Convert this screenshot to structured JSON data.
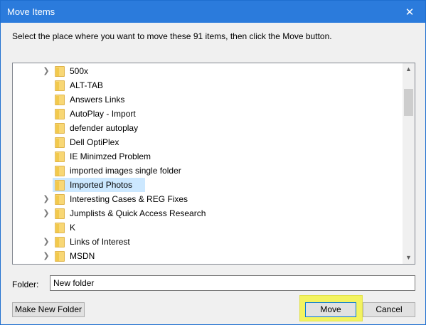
{
  "window": {
    "title": "Move Items"
  },
  "instruction": "Select the place where you want to move these 91 items, then click the Move button.",
  "tree": {
    "items": [
      {
        "label": "500x",
        "expandable": true,
        "selected": false
      },
      {
        "label": "ALT-TAB",
        "expandable": false,
        "selected": false
      },
      {
        "label": "Answers Links",
        "expandable": false,
        "selected": false
      },
      {
        "label": "AutoPlay - Import",
        "expandable": false,
        "selected": false
      },
      {
        "label": "defender autoplay",
        "expandable": false,
        "selected": false
      },
      {
        "label": "Dell OptiPlex",
        "expandable": false,
        "selected": false
      },
      {
        "label": "IE Minimzed Problem",
        "expandable": false,
        "selected": false
      },
      {
        "label": "imported images single folder",
        "expandable": false,
        "selected": false
      },
      {
        "label": "Imported Photos",
        "expandable": false,
        "selected": true
      },
      {
        "label": "Interesting Cases & REG Fixes",
        "expandable": true,
        "selected": false
      },
      {
        "label": "Jumplists & Quick Access Research",
        "expandable": true,
        "selected": false
      },
      {
        "label": "K",
        "expandable": false,
        "selected": false
      },
      {
        "label": "Links of Interest",
        "expandable": true,
        "selected": false
      },
      {
        "label": "MSDN",
        "expandable": true,
        "selected": false
      }
    ]
  },
  "folder": {
    "label": "Folder:",
    "value": "New folder"
  },
  "buttons": {
    "make_new_folder": "Make New Folder",
    "move": "Move",
    "cancel": "Cancel"
  },
  "colors": {
    "titlebar": "#2b7bdc",
    "selection": "#cce8ff",
    "highlight": "#f3f360",
    "folder": "#f8d775"
  }
}
